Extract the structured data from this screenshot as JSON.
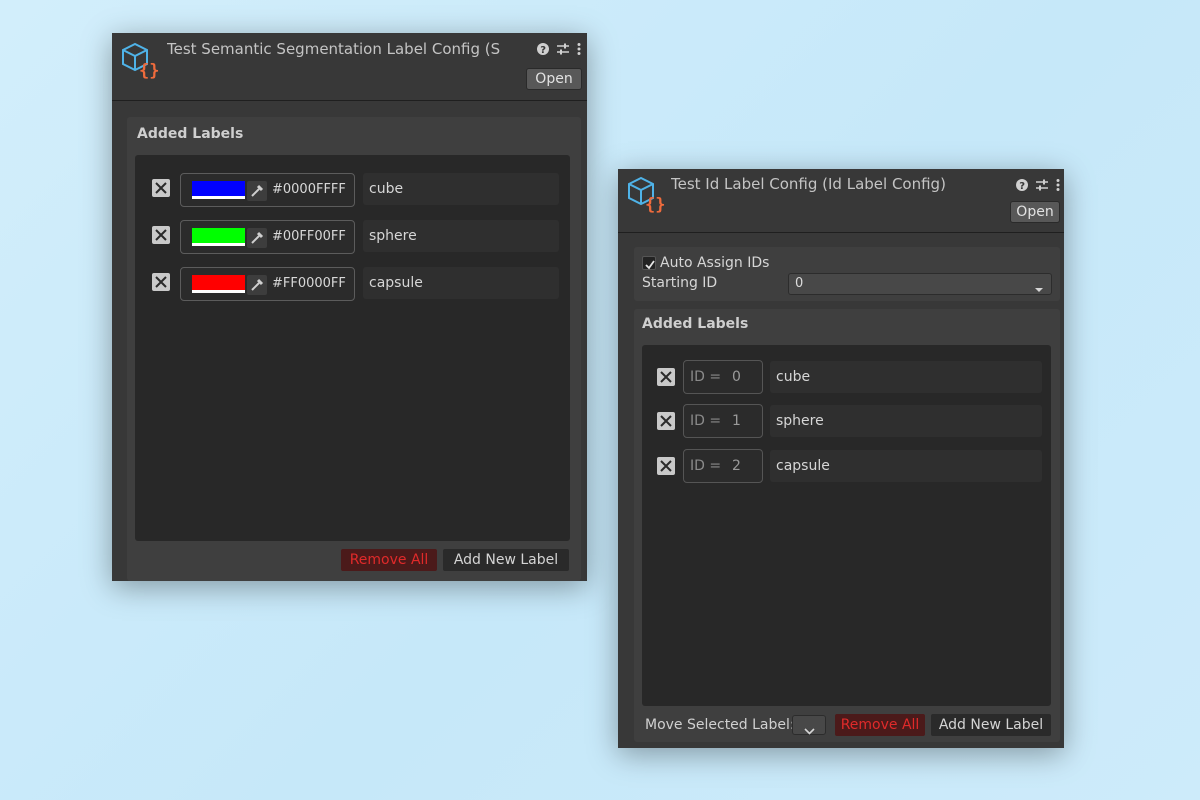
{
  "semantic_panel": {
    "title": "Test Semantic Segmentation Label Config (S",
    "open_label": "Open",
    "section_title": "Added Labels",
    "labels": [
      {
        "color": "#0000FF",
        "hex": "#0000FFFF",
        "name": "cube"
      },
      {
        "color": "#00FF00",
        "hex": "#00FF00FF",
        "name": "sphere"
      },
      {
        "color": "#FF0000",
        "hex": "#FF0000FF",
        "name": "capsule"
      }
    ],
    "remove_all_label": "Remove All",
    "add_new_label": "Add New Label"
  },
  "id_panel": {
    "title": "Test Id Label Config (Id Label Config)",
    "open_label": "Open",
    "auto_assign_label": "Auto Assign IDs",
    "auto_assign_checked": true,
    "starting_id_label": "Starting ID",
    "starting_id_value": "0",
    "section_title": "Added Labels",
    "labels": [
      {
        "id_prefix": "ID =",
        "id": "0",
        "name": "cube"
      },
      {
        "id_prefix": "ID =",
        "id": "1",
        "name": "sphere"
      },
      {
        "id_prefix": "ID =",
        "id": "2",
        "name": "capsule"
      }
    ],
    "move_selected_label": "Move Selected Label:",
    "remove_all_label": "Remove All",
    "add_new_label": "Add New Label"
  },
  "icons": {
    "logo": "config-asset-icon",
    "help": "help-icon",
    "settings": "settings-sliders-icon",
    "menu": "kebab-menu-icon",
    "remove": "close-icon",
    "picker": "eyedropper-icon"
  },
  "colors": {
    "remove_text": "#e02a2a",
    "panel_bg": "#383838",
    "list_bg": "#282828",
    "logo_cube": "#4fb3e8",
    "logo_braces": "#ef6b3c"
  }
}
